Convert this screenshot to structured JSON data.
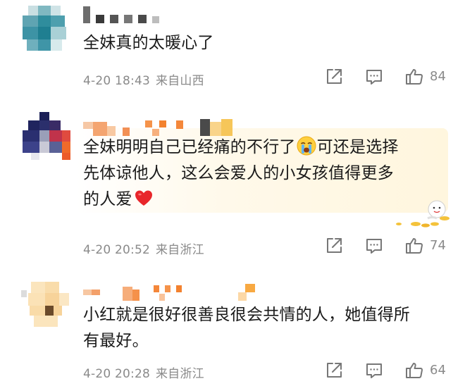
{
  "comments": [
    {
      "text": "全妹真的太暖心了",
      "time": "4-20 18:43",
      "location": "来自山西",
      "likes": "84"
    },
    {
      "text_line1_before": "全妹明明自己已经痛的不行了",
      "text_line1_after": "可还是选择",
      "text_line2": "先体谅他人，这么会爱人的小女孩值得更多",
      "text_line3": "的人爱",
      "time": "4-20 20:52",
      "location": "来自浙江",
      "likes": "74",
      "emojis": [
        "crying-face-emoji",
        "red-heart-emoji"
      ]
    },
    {
      "text_line1": "小红就是很好很善良很会共情的人，她值得所",
      "text_line2": "有最好。",
      "time": "4-20 20:28",
      "location": "来自浙江",
      "likes": "64"
    }
  ],
  "icons": [
    "share-icon",
    "reply-icon",
    "like-icon"
  ],
  "colors": {
    "text": "#1a1a1a",
    "meta": "#8a8a8a",
    "icon": "#777777",
    "highlight_bg": "#fff6de"
  }
}
